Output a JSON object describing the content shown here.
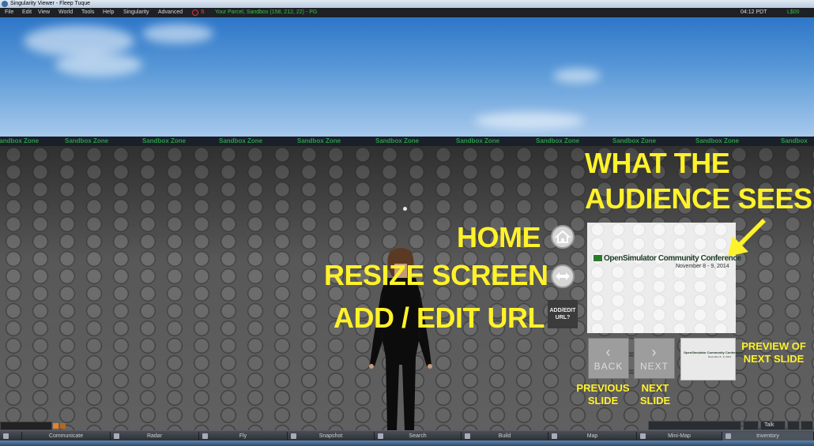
{
  "window": {
    "title": "Singularity Viewer - Fleep Tuque"
  },
  "menubar": {
    "items": [
      "File",
      "Edit",
      "View",
      "World",
      "Tools",
      "Help",
      "Singularity",
      "Advanced"
    ],
    "parcel": "Your Parcel, Sandbox (158, 212, 22) - PG",
    "clock": "04:12 PDT",
    "balance": "L$00"
  },
  "zone_strip": {
    "text": "Sandbox Zone"
  },
  "annotations": {
    "audience_line1": "WHAT THE",
    "audience_line2": "AUDIENCE SEES",
    "home": "HOME",
    "resize": "RESIZE SCREEN",
    "add_edit": "ADD / EDIT URL",
    "previous_slide": "PREVIOUS SLIDE",
    "next_slide": "NEXT SLIDE",
    "preview_next": "PREVIEW OF NEXT SLIDE"
  },
  "screen": {
    "url_button": "ADD/EDIT URL?",
    "conference": "OpenSimulator Community Conference",
    "dates": "November 8 - 9, 2014",
    "back_label": "BACK",
    "next_label": "NEXT"
  },
  "bottom": {
    "chat_placeholder": "",
    "talk_label": "Talk"
  },
  "toolbar": {
    "items": [
      "Communicate",
      "Radar",
      "Fly",
      "Snapshot",
      "Search",
      "Build",
      "Map",
      "Mini-Map",
      "Inventory"
    ]
  },
  "colors": {
    "accent": "#fff22a",
    "sky": "#4d8fd6",
    "green": "#3fbf3f"
  }
}
